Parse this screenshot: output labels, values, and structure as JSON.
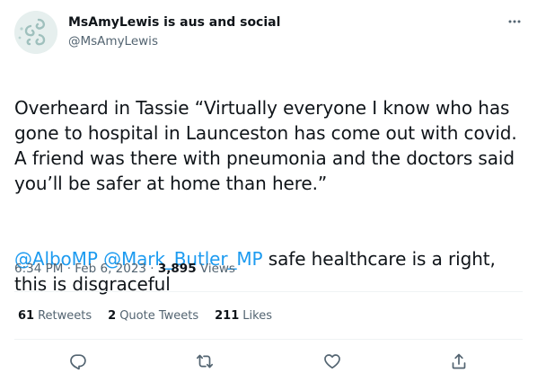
{
  "author": {
    "display_name": "MsAmyLewis is aus and social",
    "handle": "@MsAmyLewis",
    "avatar_icon": "spiral-swirl-avatar"
  },
  "tweet": {
    "text_line1": "Overheard in Tassie “Virtually everyone I know who has gone to hospital in Launceston has come out with covid. A friend was there with pneumonia and the doctors said you’ll be safer at home than here.”",
    "mention1": "@AlboMP",
    "mention2": "@Mark_Butler_MP",
    "text_line2": " safe healthcare is a right, this is disgraceful"
  },
  "meta": {
    "time": "6:34 PM",
    "sep1": " · ",
    "date": "Feb 6, 2023",
    "sep2": " · ",
    "views_count": "3,895",
    "views_label": " Views"
  },
  "stats": {
    "retweets_count": "61",
    "retweets_label": "Retweets",
    "quotes_count": "2",
    "quotes_label": "Quote Tweets",
    "likes_count": "211",
    "likes_label": "Likes"
  },
  "colors": {
    "accent": "#1d9bf0",
    "text": "#0f1419",
    "secondary": "#536471",
    "divider": "#eff3f4"
  },
  "icons": {
    "more": "more-dots-icon",
    "reply": "reply-icon",
    "retweet": "retweet-icon",
    "like": "heart-icon",
    "share": "share-icon"
  }
}
